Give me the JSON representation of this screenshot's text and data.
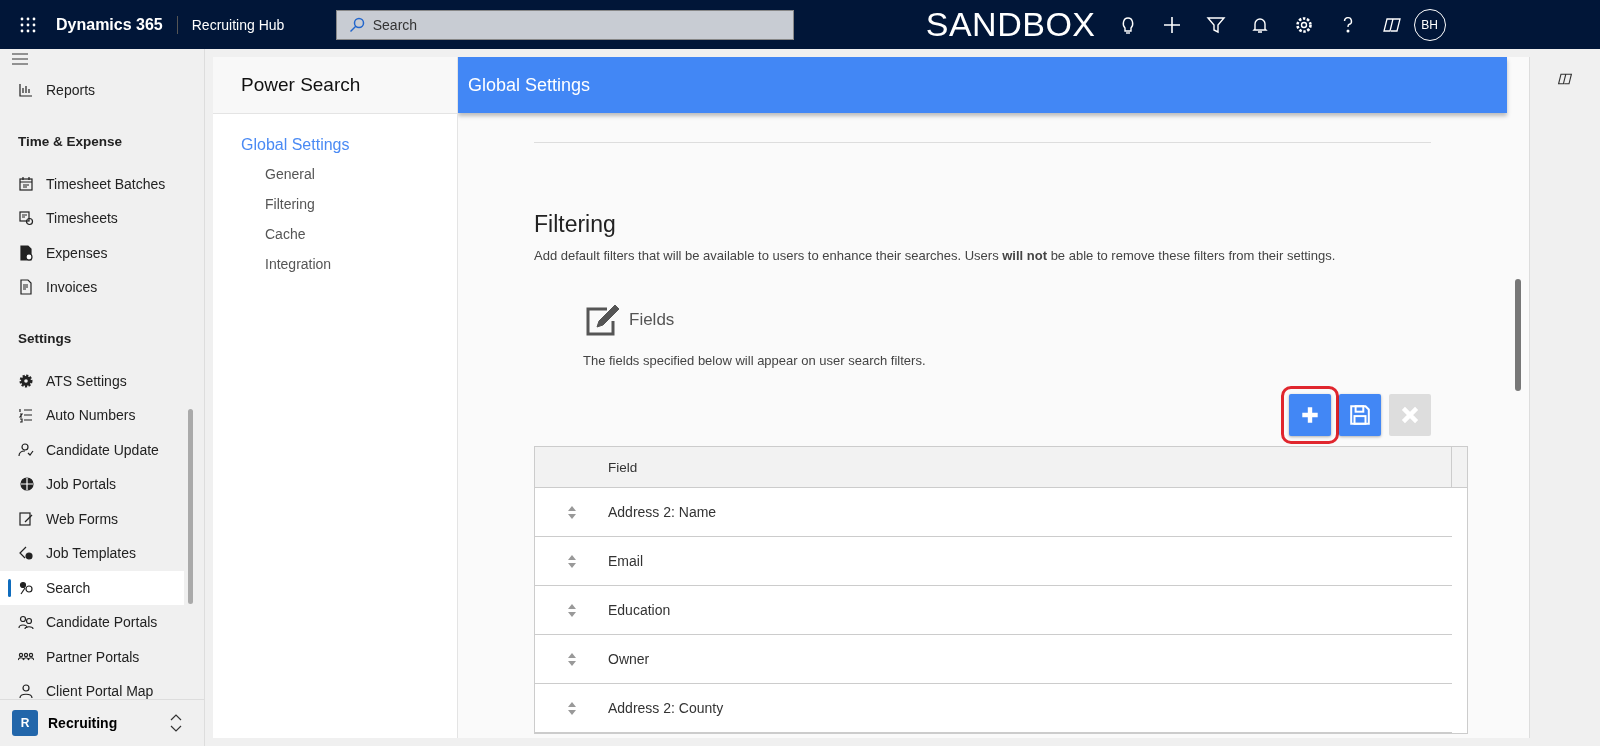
{
  "top_bar": {
    "brand": "Dynamics 365",
    "app_name": "Recruiting Hub",
    "search": {
      "placeholder": "Search"
    },
    "environment": "SANDBOX",
    "avatar": "BH"
  },
  "sidebar": {
    "sections": [
      {
        "items": [
          {
            "label": "Reports",
            "selected": false
          }
        ]
      },
      {
        "title": "Time & Expense",
        "items": [
          {
            "label": "Timesheet Batches",
            "selected": false
          },
          {
            "label": "Timesheets",
            "selected": false
          },
          {
            "label": "Expenses",
            "selected": false
          },
          {
            "label": "Invoices",
            "selected": false
          }
        ]
      },
      {
        "title": "Settings",
        "items": [
          {
            "label": "ATS Settings",
            "selected": false
          },
          {
            "label": "Auto Numbers",
            "selected": false
          },
          {
            "label": "Candidate Update",
            "selected": false
          },
          {
            "label": "Job Portals",
            "selected": false
          },
          {
            "label": "Web Forms",
            "selected": false
          },
          {
            "label": "Job Templates",
            "selected": false
          },
          {
            "label": "Search",
            "selected": true
          },
          {
            "label": "Candidate Portals",
            "selected": false
          },
          {
            "label": "Partner Portals",
            "selected": false
          },
          {
            "label": "Client Portal Map",
            "selected": false
          }
        ]
      }
    ],
    "area": {
      "badge": "R",
      "label": "Recruiting"
    }
  },
  "nav": {
    "title": "Power Search",
    "group": "Global Settings",
    "items": [
      {
        "label": "General",
        "selected": false
      },
      {
        "label": "Filtering",
        "selected": false
      },
      {
        "label": "Cache",
        "selected": false
      },
      {
        "label": "Integration",
        "selected": false
      }
    ]
  },
  "content": {
    "header": "Global Settings",
    "section_title": "Filtering",
    "section_text": "Add default filters that will be available to users to enhance their searches. Users **will not** be able to remove these filters from their settings.",
    "card": {
      "title": "Fields",
      "text": "The fields specified below will appear on user search filters."
    },
    "toolbar": [
      {
        "kind": "add",
        "disabled": false,
        "highlighted": true
      },
      {
        "kind": "save",
        "disabled": false,
        "highlighted": false
      },
      {
        "kind": "delete",
        "disabled": true,
        "highlighted": false
      }
    ],
    "table": {
      "columns": [
        "Field"
      ],
      "rows": [
        "Address 2: Name",
        "Email",
        "Education",
        "Owner",
        "Address 2: County"
      ]
    }
  }
}
